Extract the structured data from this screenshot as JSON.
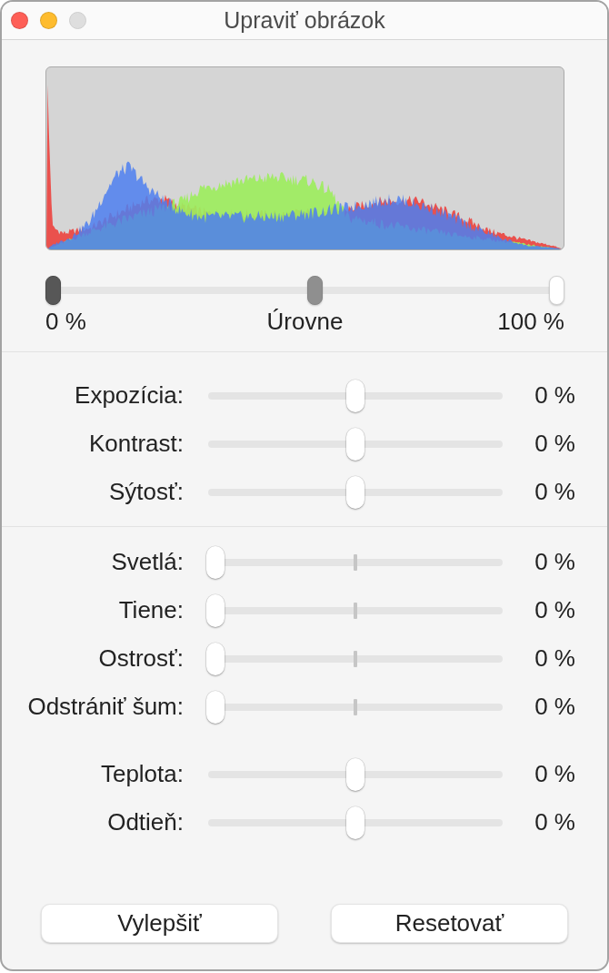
{
  "window": {
    "title": "Upraviť obrázok",
    "controls": [
      {
        "kind": "close",
        "disabled": false
      },
      {
        "kind": "minimize",
        "disabled": false
      },
      {
        "kind": "zoom",
        "disabled": true
      }
    ]
  },
  "levels": {
    "handles": [
      {
        "kind": "black",
        "level": 0
      },
      {
        "kind": "midtone",
        "level": 0.52
      },
      {
        "kind": "white",
        "level": 1
      }
    ],
    "min_label": "0 %",
    "label": "Úrovne",
    "max_label": "100 %"
  },
  "sections": [
    {
      "divider_above": true,
      "sliders": [
        {
          "label": "Expozícia:",
          "level": 0.5,
          "value": "0 %",
          "tick_mark": false
        },
        {
          "label": "Kontrast:",
          "level": 0.5,
          "value": "0 %",
          "tick_mark": false
        },
        {
          "label": "Sýtosť:",
          "level": 0.5,
          "value": "0 %",
          "tick_mark": false
        }
      ]
    },
    {
      "divider_above": true,
      "sliders": [
        {
          "label": "Svetlá:",
          "level": 0,
          "value": "0 %",
          "tick_mark": true
        },
        {
          "label": "Tiene:",
          "level": 0,
          "value": "0 %",
          "tick_mark": true
        },
        {
          "label": "Ostrosť:",
          "level": 0,
          "value": "0 %",
          "tick_mark": true
        },
        {
          "label": "Odstrániť šum:",
          "level": 0,
          "value": "0 %",
          "tick_mark": true
        }
      ]
    },
    {
      "divider_above": false,
      "sliders": [
        {
          "label": "Teplota:",
          "level": 0.5,
          "value": "0 %",
          "tick_mark": false
        },
        {
          "label": "Odtieň:",
          "level": 0.5,
          "value": "0 %",
          "tick_mark": false
        }
      ]
    }
  ],
  "buttons": [
    "Vylepšiť",
    "Resetovať"
  ]
}
